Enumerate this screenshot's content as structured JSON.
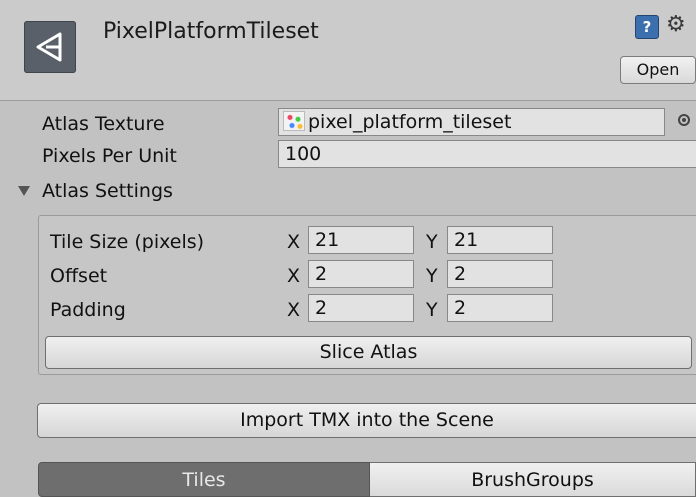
{
  "header": {
    "title": "PixelPlatformTileset",
    "open_label": "Open",
    "help_glyph": "?",
    "gear_glyph": "⚙"
  },
  "fields": {
    "atlas_texture_label": "Atlas Texture",
    "atlas_texture_value": "pixel_platform_tileset",
    "pixels_per_unit_label": "Pixels Per Unit",
    "pixels_per_unit_value": "100"
  },
  "atlas_settings": {
    "label": "Atlas Settings",
    "rows": [
      {
        "label": "Tile Size (pixels)",
        "x": "21",
        "y": "21"
      },
      {
        "label": "Offset",
        "x": "2",
        "y": "2"
      },
      {
        "label": "Padding",
        "x": "2",
        "y": "2"
      }
    ],
    "x_axis": "X",
    "y_axis": "Y",
    "slice_label": "Slice Atlas"
  },
  "import_label": "Import TMX into the Scene",
  "tabs": [
    {
      "label": "Tiles",
      "active": true
    },
    {
      "label": "BrushGroups",
      "active": false
    }
  ]
}
